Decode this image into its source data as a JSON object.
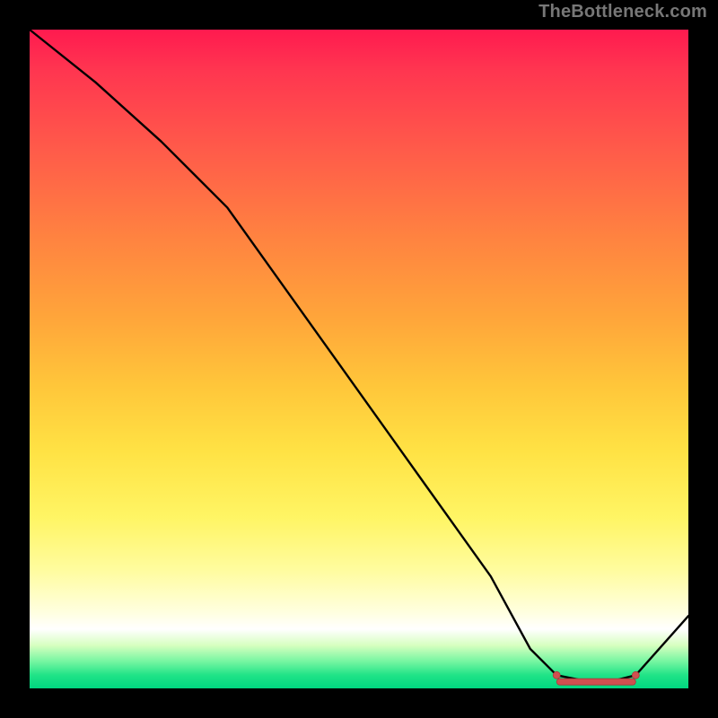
{
  "watermark": "TheBottleneck.com",
  "chart_data": {
    "type": "line",
    "title": "",
    "xlabel": "",
    "ylabel": "",
    "xlim": [
      0,
      100
    ],
    "ylim": [
      0,
      100
    ],
    "grid": false,
    "legend": false,
    "description": "Bottleneck curve over a rainbow gradient background. Lower y (near the green bottom band) indicates a better match; the curve starts at maximum at x=0 and descends to a minimum near x≈80–90 before rising again at x=100.",
    "series": [
      {
        "name": "bottleneck-curve",
        "x": [
          0,
          10,
          20,
          25,
          30,
          40,
          50,
          60,
          70,
          76,
          80,
          85,
          88,
          92,
          100
        ],
        "values": [
          100,
          92,
          83,
          78,
          73,
          59,
          45,
          31,
          17,
          6,
          2,
          1,
          1,
          2,
          11
        ]
      }
    ],
    "markers": {
      "comment": "Cluster of small red markers along the valley of the curve between x≈80 and x≈92",
      "x": [
        80,
        82,
        84,
        86,
        88,
        90,
        92
      ],
      "values": [
        2,
        1.5,
        1,
        1,
        1,
        1.3,
        2
      ]
    }
  }
}
